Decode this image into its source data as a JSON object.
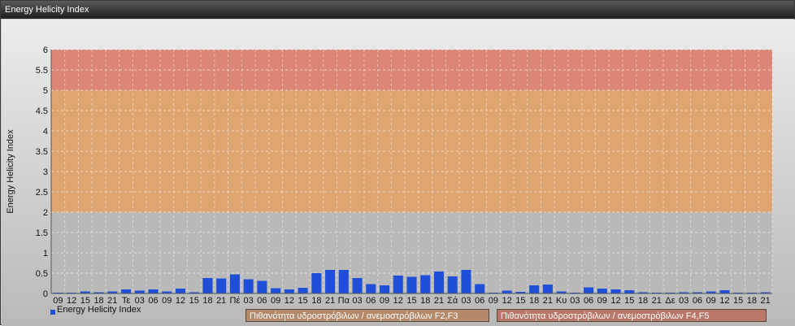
{
  "window": {
    "title": "Energy Helicity Index"
  },
  "chart_data": {
    "type": "bar",
    "title": "",
    "ylabel": "Energy Helicity Index",
    "xlabel": "",
    "ylim": [
      0,
      6
    ],
    "yticks": [
      "0",
      "0.5",
      "1",
      "1.5",
      "2",
      "2.5",
      "3",
      "3.5",
      "4",
      "4.5",
      "5",
      "5.5",
      "6"
    ],
    "grid": true,
    "categories": [
      "09",
      "12",
      "15",
      "18",
      "21",
      "Τε",
      "03",
      "06",
      "09",
      "12",
      "15",
      "18",
      "21",
      "Πέ",
      "03",
      "06",
      "09",
      "12",
      "15",
      "18",
      "21",
      "Πα",
      "03",
      "06",
      "09",
      "12",
      "15",
      "18",
      "21",
      "Σά",
      "03",
      "06",
      "09",
      "12",
      "15",
      "18",
      "21",
      "Κυ",
      "03",
      "06",
      "09",
      "12",
      "15",
      "18",
      "21",
      "Δε",
      "03",
      "06",
      "09",
      "12",
      "15",
      "18",
      "21"
    ],
    "series": [
      {
        "name": "Energy Helicity Index",
        "color": "#1f4fd8",
        "values": [
          0.02,
          0.02,
          0.05,
          0.03,
          0.05,
          0.1,
          0.07,
          0.1,
          0.05,
          0.12,
          0.03,
          0.38,
          0.37,
          0.47,
          0.35,
          0.31,
          0.13,
          0.1,
          0.14,
          0.5,
          0.58,
          0.58,
          0.38,
          0.23,
          0.2,
          0.44,
          0.41,
          0.45,
          0.54,
          0.42,
          0.58,
          0.23,
          0.02,
          0.07,
          0.04,
          0.2,
          0.22,
          0.05,
          0.02,
          0.15,
          0.12,
          0.1,
          0.08,
          0.03,
          0.02,
          0.02,
          0.03,
          0.03,
          0.05,
          0.08,
          0.02,
          0.02,
          0.03
        ]
      }
    ],
    "bands": [
      {
        "from": 0,
        "to": 2,
        "color": "#b7b7b7"
      },
      {
        "from": 2,
        "to": 5,
        "color": "#e3a063"
      },
      {
        "from": 5,
        "to": 6,
        "color": "#e07b6a"
      }
    ],
    "legend": {
      "position": "bottom",
      "items": [
        {
          "label": "Energy Helicity Index",
          "color": "#1f4fd8"
        },
        {
          "label": "Πιθανότητα υδροστρόβιλων / ανεμοστρόβιλων F2,F3",
          "color": "#b4896a"
        },
        {
          "label": "Πιθανότητα υδροστρόβιλων / ανεμοστρόβιλων F4,F5",
          "color": "#b9776a"
        }
      ]
    }
  }
}
